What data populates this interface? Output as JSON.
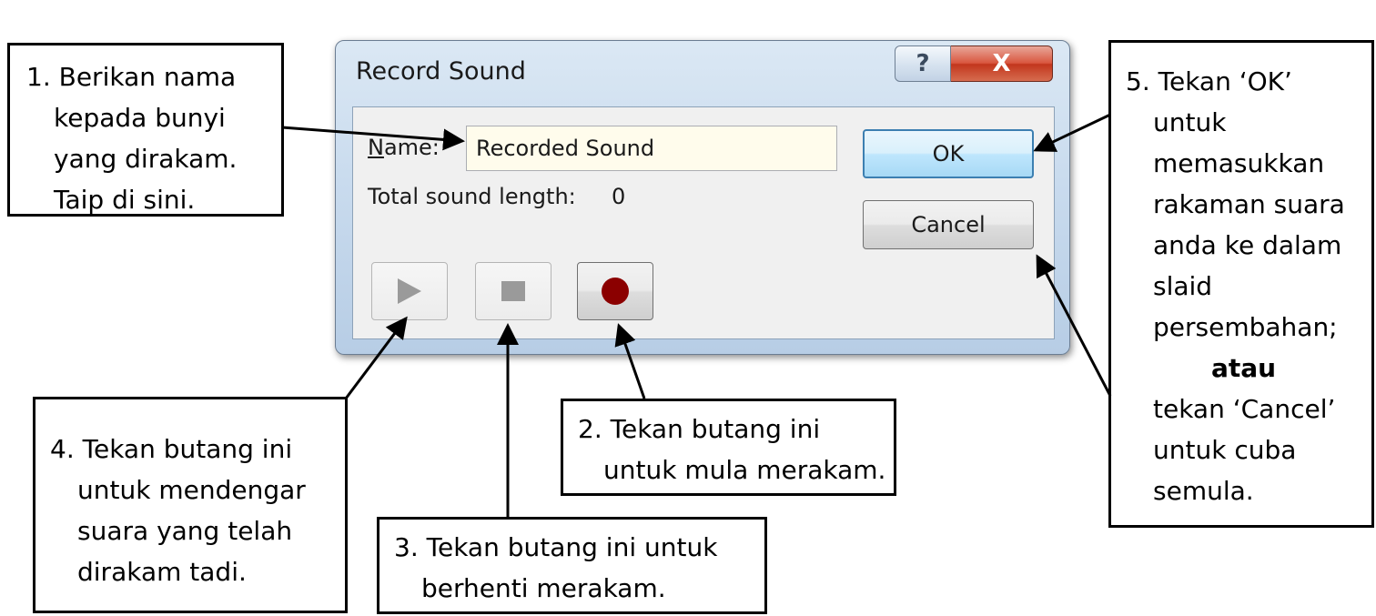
{
  "dialog": {
    "title": "Record Sound",
    "help_glyph": "?",
    "close_glyph": "X",
    "name_label_underlined": "N",
    "name_label_rest": "ame:",
    "name_value": "Recorded Sound",
    "length_label": "Total sound length:",
    "length_value": "0",
    "ok_label": "OK",
    "cancel_label": "Cancel",
    "play_icon": "play-triangle",
    "stop_icon": "stop-square",
    "record_icon": "record-dot",
    "record_color": "#8b0000"
  },
  "callouts": {
    "c1": [
      "1. Berikan nama",
      "kepada bunyi",
      "yang dirakam.",
      "Taip di sini."
    ],
    "c2": [
      "2. Tekan butang ini",
      "untuk mula merakam."
    ],
    "c3": [
      "3. Tekan butang ini untuk",
      "berhenti merakam."
    ],
    "c4": [
      "4. Tekan butang ini",
      "untuk mendengar",
      "suara yang telah",
      "dirakam tadi."
    ],
    "c5": [
      "5. Tekan ‘OK’",
      "untuk",
      "memasukkan",
      "rakaman suara",
      "anda ke dalam",
      "slaid",
      "persembahan;",
      "atau",
      "tekan ‘Cancel’",
      "untuk cuba",
      "semula."
    ]
  }
}
